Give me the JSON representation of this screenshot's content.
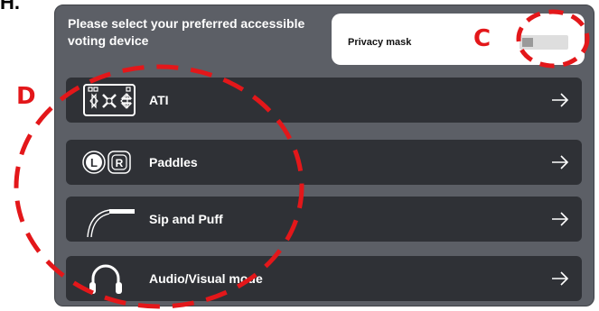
{
  "page": {
    "corner_text": "H."
  },
  "dialog": {
    "heading": "Please select your preferred accessible voting device",
    "privacy_mask": {
      "label": "Privacy mask",
      "enabled": false
    }
  },
  "options": [
    {
      "label": "ATI",
      "icon": "ati-keypad-icon"
    },
    {
      "label": "Paddles",
      "icon": "paddles-icon"
    },
    {
      "label": "Sip and Puff",
      "icon": "sip-and-puff-icon"
    },
    {
      "label": "Audio/Visual mode",
      "icon": "headphones-icon"
    }
  ],
  "annotations": {
    "c": "C",
    "d": "D",
    "color": "#e3171a"
  },
  "colors": {
    "panel": "#5c5f66",
    "option_button": "#2f3136",
    "privacy_card": "#ffffff"
  }
}
